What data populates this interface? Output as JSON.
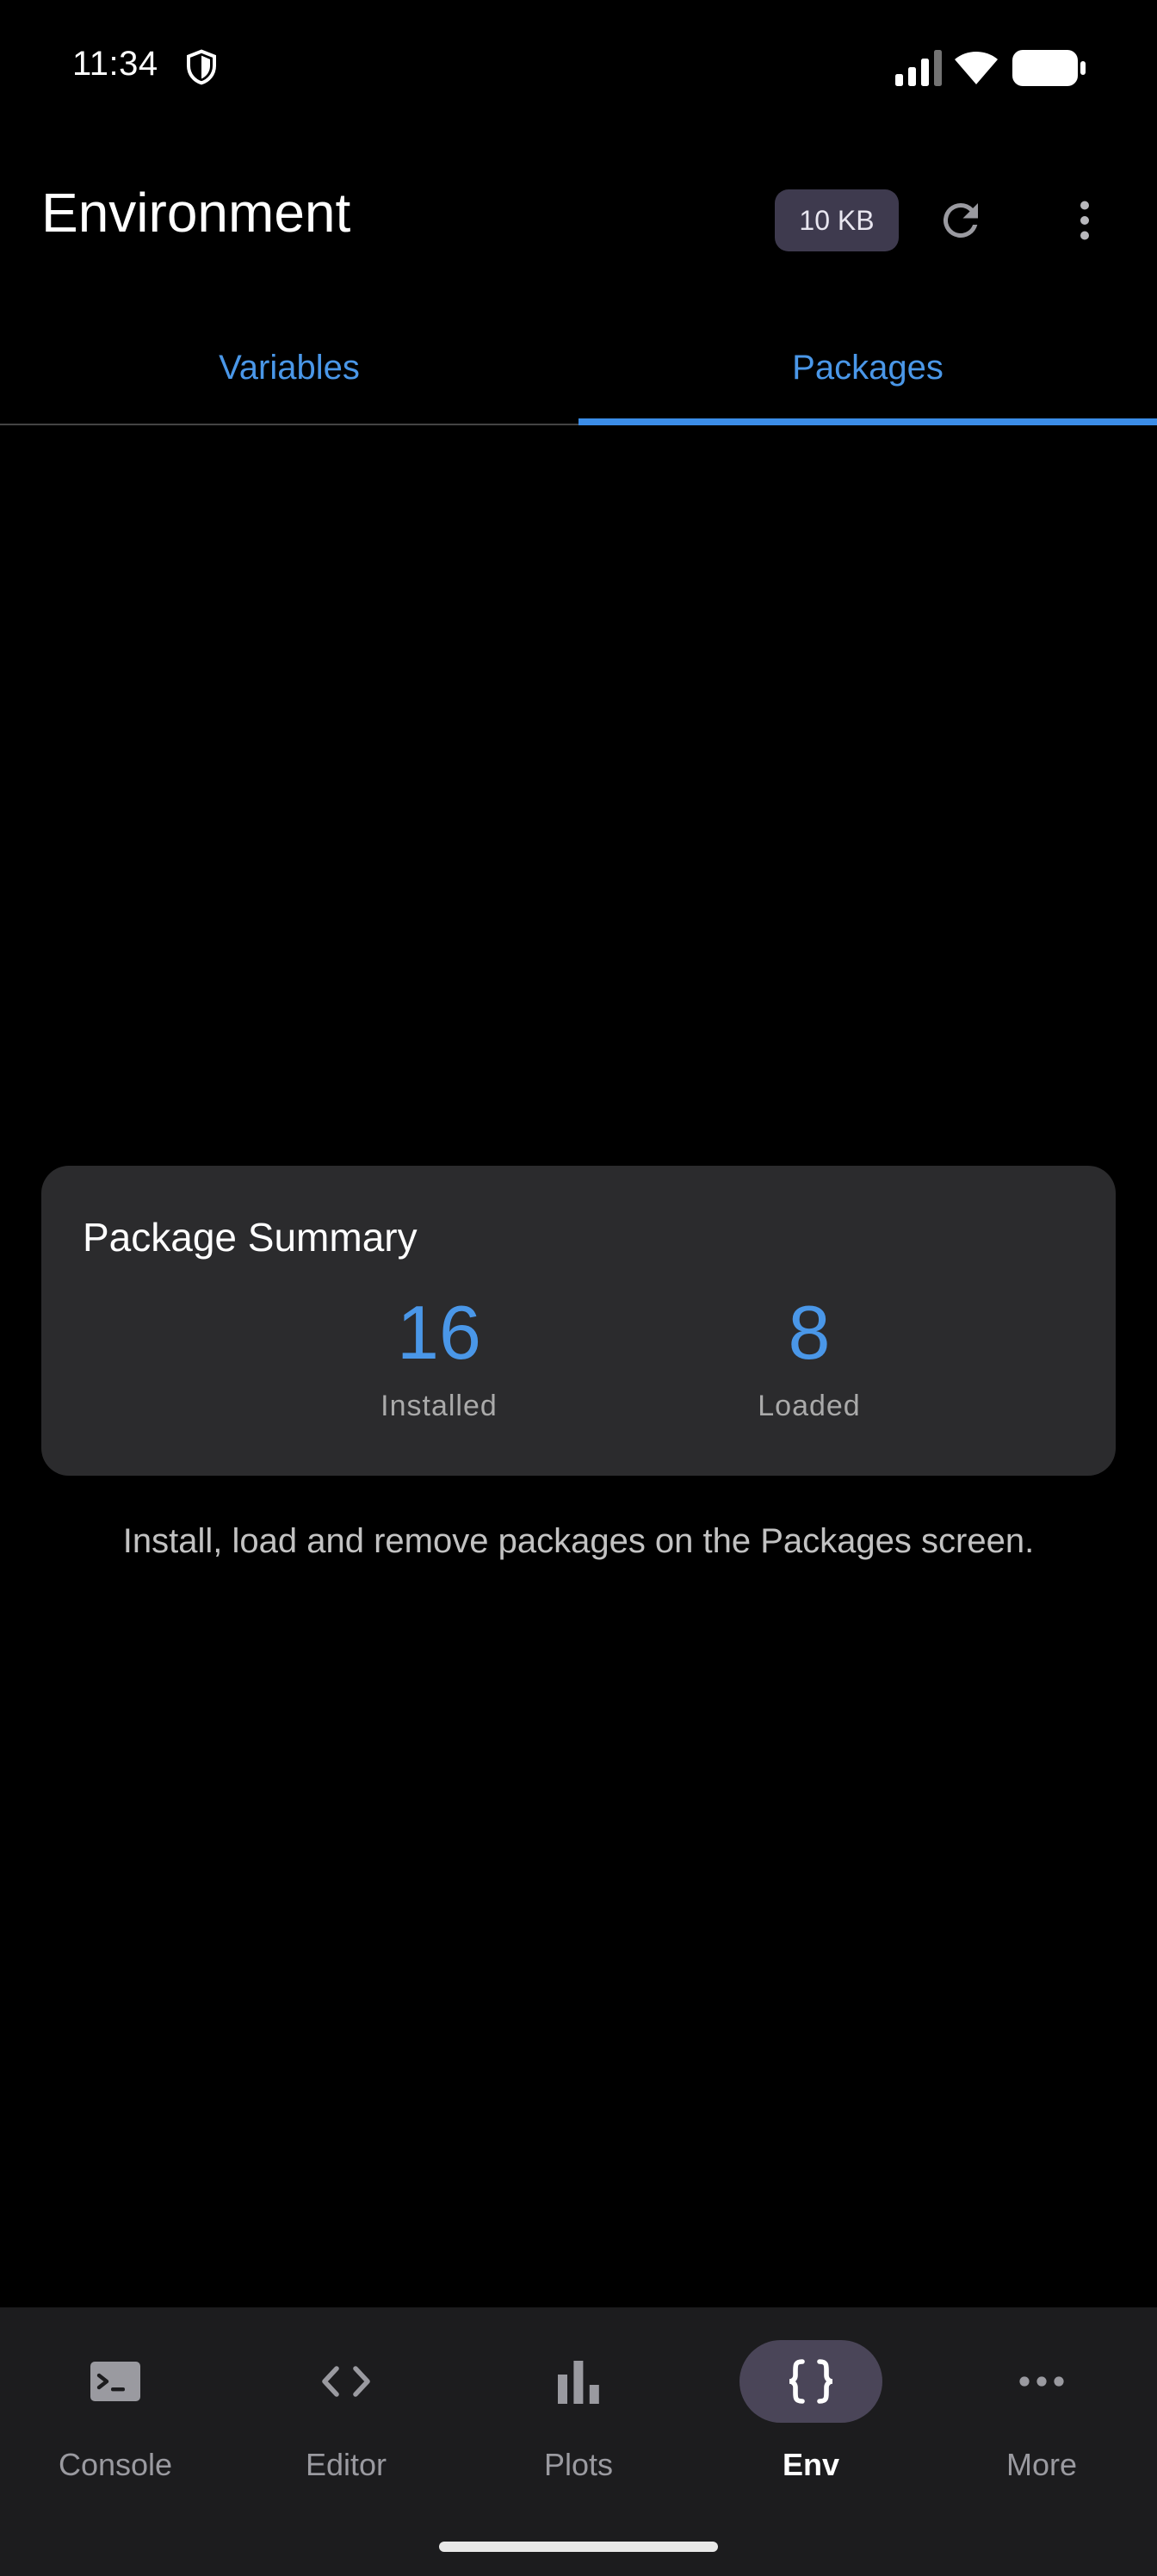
{
  "status_bar": {
    "time": "11:34"
  },
  "app_bar": {
    "title": "Environment",
    "memory_badge": "10 KB"
  },
  "tabs": [
    {
      "label": "Variables",
      "selected": false
    },
    {
      "label": "Packages",
      "selected": true
    }
  ],
  "summary": {
    "title": "Package Summary",
    "installed_value": "16",
    "installed_label": "Installed",
    "loaded_value": "8",
    "loaded_label": "Loaded"
  },
  "hint": "Install, load and remove packages on the Packages screen.",
  "bottom_nav": [
    {
      "label": "Console",
      "icon": "console-icon",
      "active": false
    },
    {
      "label": "Editor",
      "icon": "code-icon",
      "active": false
    },
    {
      "label": "Plots",
      "icon": "bar-chart-icon",
      "active": false
    },
    {
      "label": "Env",
      "icon": "braces-icon",
      "active": true
    },
    {
      "label": "More",
      "icon": "more-horizontal-icon",
      "active": false
    }
  ],
  "colors": {
    "accent": "#3b8de8",
    "accent_text": "#4a97e8",
    "card_bg": "#2b2b2d",
    "nav_bg": "#1c1c1e",
    "badge_bg": "#3e3a4e",
    "active_pill": "#4a4558"
  }
}
